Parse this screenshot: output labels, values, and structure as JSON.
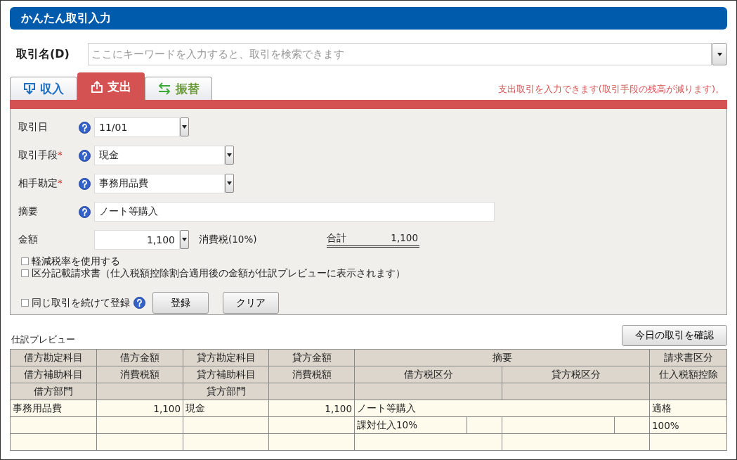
{
  "window": {
    "title": "かんたん取引入力"
  },
  "search": {
    "label": "取引名(D)",
    "placeholder": "ここにキーワードを入力すると、取引を検索できます"
  },
  "tabs": [
    {
      "label": "収入",
      "kind": "income",
      "color": "#1b6ec2",
      "selected": false
    },
    {
      "label": "支出",
      "kind": "expense",
      "color": "#d45252",
      "selected": true
    },
    {
      "label": "振替",
      "kind": "transfer",
      "color": "#6a9a3a",
      "selected": false
    }
  ],
  "tab_hint": "支出取引を入力できます(取引手段の残高が減ります)。",
  "fields": [
    {
      "label": "取引日",
      "kind": "date",
      "value": "11/01"
    },
    {
      "label": "取引手段",
      "mark": "*",
      "kind": "select",
      "value": "現金"
    },
    {
      "label": "相手勘定",
      "mark": "*",
      "kind": "select",
      "value": "事務用品費"
    },
    {
      "label": "摘要",
      "kind": "text",
      "value": "ノート等購入"
    }
  ],
  "amount": {
    "label": "金額",
    "value": "1,100",
    "tax_label": "消費税(10%)",
    "total_label": "合計",
    "total": "1,100"
  },
  "options": [
    {
      "label": "軽減税率を使用する",
      "checked": false
    },
    {
      "label": "区分記載請求書（仕入税額控除割合適用後の金額が仕訳プレビューに表示されます）",
      "checked": false
    }
  ],
  "repeat_option": {
    "label": "同じ取引を続けて登録",
    "checked": false
  },
  "buttons": [
    "登録",
    "クリア"
  ],
  "preview": {
    "title": "仕訳プレビュー",
    "today_button": "今日の取引を確認",
    "header": [
      {
        "debit_account": "借方勘定科目",
        "debit_amount": "借方金額",
        "credit_account": "貸方勘定科目",
        "credit_amount": "貸方金額",
        "description": "摘要",
        "invoice_type": "請求書区分"
      },
      {
        "debit_sub_account": "借方補助科目",
        "debit_tax": "消費税額",
        "credit_sub_account": "貸方補助科目",
        "credit_tax": "消費税額",
        "debit_tax_category": "借方税区分",
        "credit_tax_category": "貸方税区分",
        "deduction": "仕入税額控除"
      },
      {
        "debit_department": "借方部門",
        "credit_department": "貸方部門"
      }
    ],
    "rows": [
      {
        "debit_account": "事務用品費",
        "debit_amount": "1,100",
        "credit_account": "現金",
        "credit_amount": "1,100",
        "description": "ノート等購入",
        "invoice_type": "適格"
      },
      {
        "debit_tax_category": "課対仕入10%",
        "deduction": "100%"
      }
    ]
  }
}
